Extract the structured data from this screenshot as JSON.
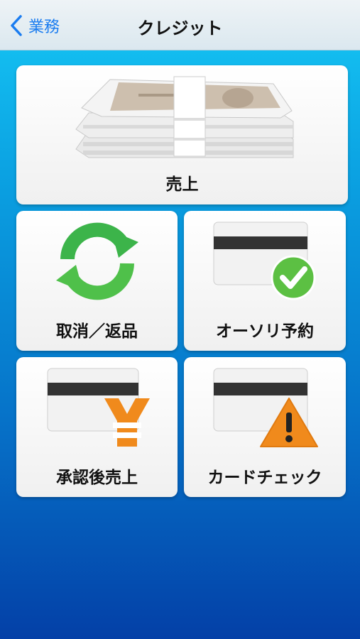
{
  "nav": {
    "back_label": "業務",
    "title": "クレジット"
  },
  "menu": {
    "sales": "売上",
    "void_return": "取消／返品",
    "authorization": "オーソリ予約",
    "post_auth_sale": "承認後売上",
    "card_check": "カードチェック"
  },
  "icons": {
    "sales": "banknote-stack-icon",
    "void_return": "refresh-arrows-icon",
    "authorization": "card-checkmark-icon",
    "post_auth_sale": "card-yen-icon",
    "card_check": "card-warning-icon"
  },
  "colors": {
    "accent": "#1a7cf0",
    "green": "#3cb44a",
    "orange": "#f08a1c"
  }
}
